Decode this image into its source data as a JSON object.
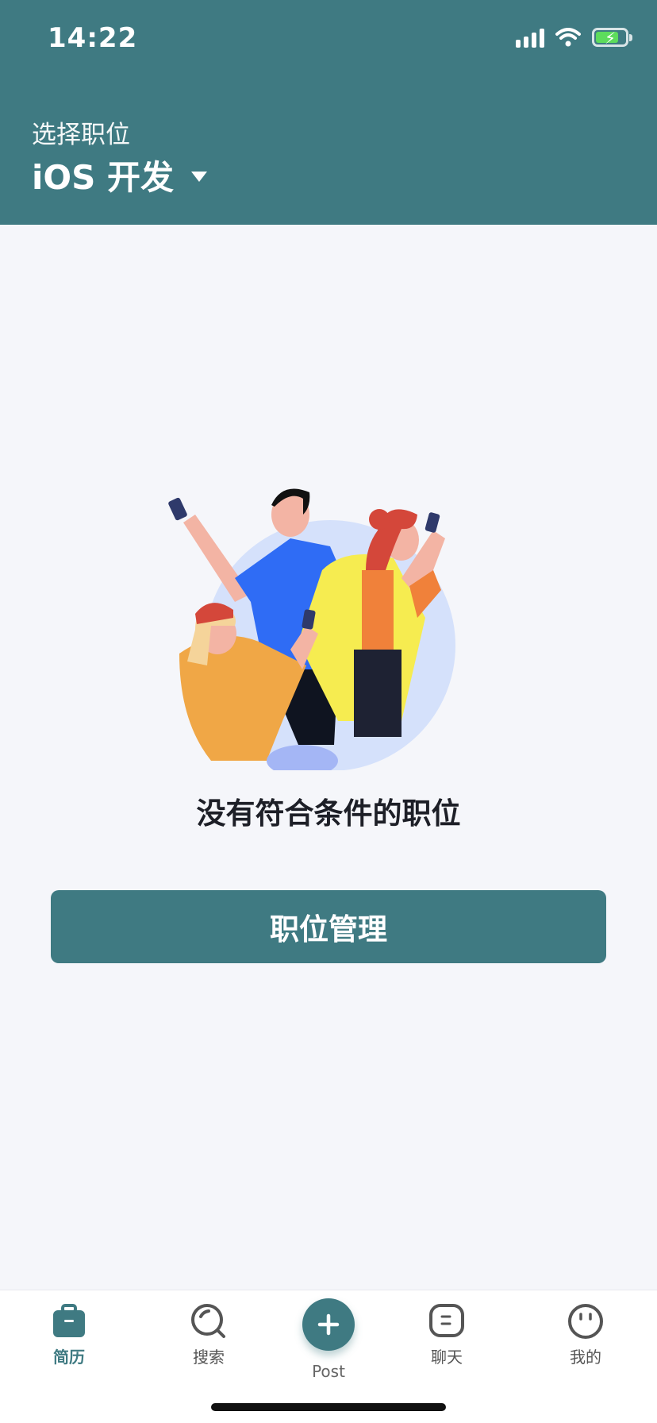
{
  "status_bar": {
    "time": "14:22"
  },
  "header": {
    "select_label": "选择职位",
    "current_role": "iOS 开发"
  },
  "empty_state": {
    "message": "没有符合条件的职位",
    "button_label": "职位管理"
  },
  "tabbar": {
    "items": [
      {
        "label": "简历",
        "icon": "briefcase-icon",
        "active": true
      },
      {
        "label": "搜索",
        "icon": "search-icon",
        "active": false
      },
      {
        "label": "Post",
        "icon": "plus-icon",
        "active": false
      },
      {
        "label": "聊天",
        "icon": "chat-icon",
        "active": false
      },
      {
        "label": "我的",
        "icon": "profile-icon",
        "active": false
      }
    ]
  },
  "colors": {
    "primary": "#3f7a82",
    "background": "#f5f6fa",
    "text": "#1d1f27"
  }
}
